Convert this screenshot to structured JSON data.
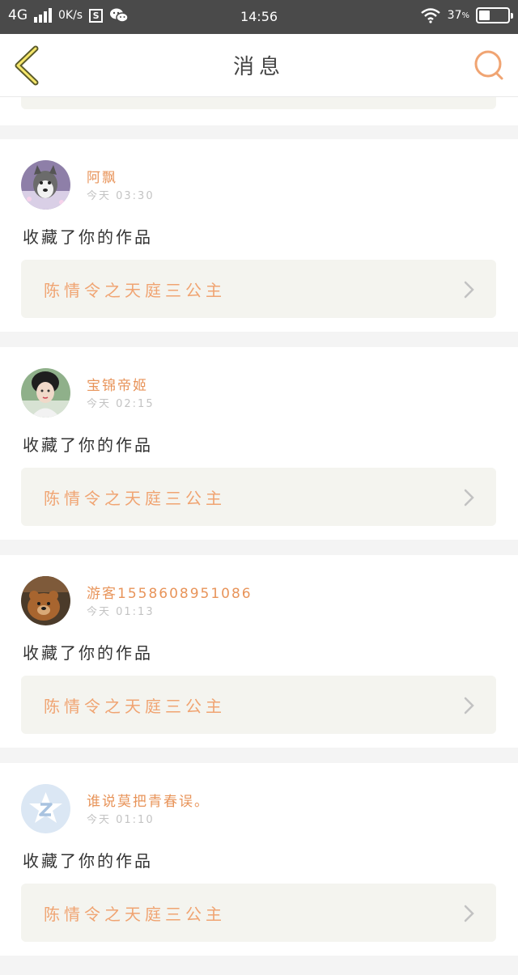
{
  "status_bar": {
    "network": "4G",
    "speed": "0K/s",
    "time": "14:56",
    "battery": "37",
    "battery_level": 0.37,
    "icons": [
      "signal-icon",
      "sim-s-icon",
      "wechat-icon",
      "wifi-icon",
      "battery-icon"
    ]
  },
  "header": {
    "title": "消息",
    "back_icon": "chevron-left-icon",
    "search_icon": "search-icon",
    "accent": "#e8945a"
  },
  "messages": [
    {
      "name": "阿飘",
      "time": "今天 03:30",
      "action": "收藏了你的作品",
      "work": "陈情令之天庭三公主",
      "avatar": "husky-photo"
    },
    {
      "name": "宝锦帝姬",
      "time": "今天 02:15",
      "action": "收藏了你的作品",
      "work": "陈情令之天庭三公主",
      "avatar": "woman-photo"
    },
    {
      "name": "游客1558608951086",
      "time": "今天 01:13",
      "action": "收藏了你的作品",
      "work": "陈情令之天庭三公主",
      "avatar": "bear-photo"
    },
    {
      "name": "谁说莫把青春误。",
      "time": "今天 01:10",
      "action": "收藏了你的作品",
      "work": "陈情令之天庭三公主",
      "avatar": "default-z-avatar"
    }
  ],
  "colors": {
    "name": "#e8945a",
    "work_title": "#f0a472",
    "link_bg": "#f4f4ef",
    "page_bg": "#f4f4f4"
  }
}
